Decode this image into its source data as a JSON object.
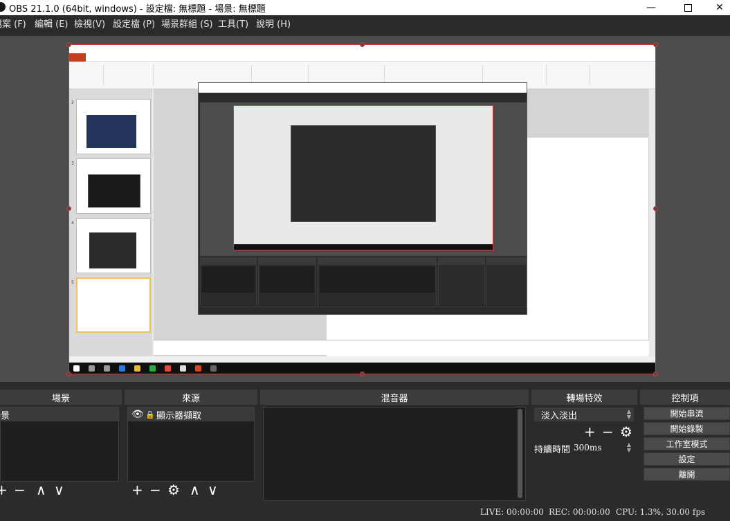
{
  "window": {
    "title": "OBS 21.1.0 (64bit, windows) - 設定檔: 無標題 - 場景: 無標題",
    "minimize_glyph": "—",
    "close_glyph": "✕"
  },
  "menu": [
    {
      "label": "檔案 (F)"
    },
    {
      "label": "編輯 (E)"
    },
    {
      "label": "檢視(V)"
    },
    {
      "label": "設定檔 (P)"
    },
    {
      "label": "場景群組 (S)"
    },
    {
      "label": "工具(T)"
    },
    {
      "label": "說明 (H)"
    }
  ],
  "panels": {
    "scenes": {
      "title": "場景",
      "items": [
        "場景"
      ]
    },
    "sources": {
      "title": "來源",
      "items": [
        "顯示器擷取"
      ]
    },
    "mixer": {
      "title": "混音器"
    },
    "transitions": {
      "title": "轉場特效",
      "selected": "淡入淡出",
      "duration_label": "持續時間",
      "duration_value": "300ms"
    },
    "controls": {
      "title": "控制項",
      "buttons": [
        "開始串流",
        "開始錄製",
        "工作室模式",
        "設定",
        "離開"
      ]
    }
  },
  "tool_glyphs": {
    "add": "+",
    "remove": "−",
    "up": "∧",
    "down": "∨",
    "gear": "⚙",
    "eye": "👁",
    "lock": "🔒"
  },
  "status": {
    "live": "LIVE: 00:00:00",
    "rec": "REC: 00:00:00",
    "cpu": "CPU: 1.3%, 30.00 fps"
  },
  "colors": {
    "accent_red": "#dd3333",
    "ppt_orange": "#c43e1c",
    "panel_bg": "#2b2b2b"
  }
}
